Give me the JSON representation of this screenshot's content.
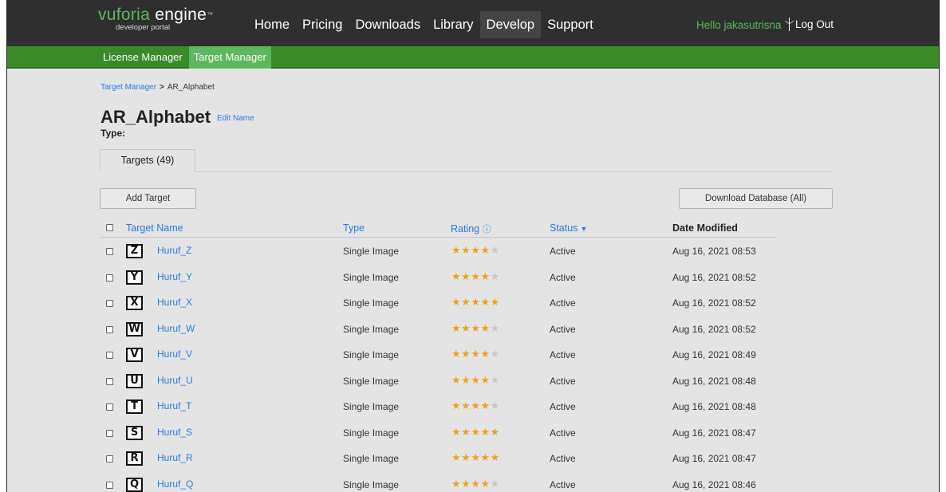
{
  "header": {
    "logo_main": "vuforia",
    "logo_engine": "engine",
    "logo_tm": "™",
    "logo_sub": "developer portal",
    "nav": [
      "Home",
      "Pricing",
      "Downloads",
      "Library",
      "Develop",
      "Support"
    ],
    "active_nav": "Develop",
    "greeting": "Hello jakasutrisna",
    "logout": "Log Out"
  },
  "subnav": {
    "items": [
      "License Manager",
      "Target Manager"
    ],
    "active": "Target Manager"
  },
  "breadcrumb": {
    "parent": "Target Manager",
    "separator": ">",
    "current": "AR_Alphabet"
  },
  "database": {
    "name": "AR_Alphabet",
    "edit_label": "Edit Name",
    "type_label": "Type:"
  },
  "tabs": [
    "Targets (49)"
  ],
  "actions": {
    "add_target": "Add Target",
    "download": "Download Database (All)"
  },
  "table": {
    "columns": {
      "name": "Target Name",
      "type": "Type",
      "rating": "Rating",
      "status": "Status",
      "date": "Date Modified"
    },
    "rows": [
      {
        "letter": "Z",
        "name": "Huruf_Z",
        "type": "Single Image",
        "rating": 4,
        "status": "Active",
        "date": "Aug 16, 2021 08:53"
      },
      {
        "letter": "Y",
        "name": "Huruf_Y",
        "type": "Single Image",
        "rating": 4,
        "status": "Active",
        "date": "Aug 16, 2021 08:52"
      },
      {
        "letter": "X",
        "name": "Huruf_X",
        "type": "Single Image",
        "rating": 5,
        "status": "Active",
        "date": "Aug 16, 2021 08:52"
      },
      {
        "letter": "W",
        "name": "Huruf_W",
        "type": "Single Image",
        "rating": 4,
        "status": "Active",
        "date": "Aug 16, 2021 08:52"
      },
      {
        "letter": "V",
        "name": "Huruf_V",
        "type": "Single Image",
        "rating": 4,
        "status": "Active",
        "date": "Aug 16, 2021 08:49"
      },
      {
        "letter": "U",
        "name": "Huruf_U",
        "type": "Single Image",
        "rating": 4,
        "status": "Active",
        "date": "Aug 16, 2021 08:48"
      },
      {
        "letter": "T",
        "name": "Huruf_T",
        "type": "Single Image",
        "rating": 4,
        "status": "Active",
        "date": "Aug 16, 2021 08:48"
      },
      {
        "letter": "S",
        "name": "Huruf_S",
        "type": "Single Image",
        "rating": 5,
        "status": "Active",
        "date": "Aug 16, 2021 08:47"
      },
      {
        "letter": "R",
        "name": "Huruf_R",
        "type": "Single Image",
        "rating": 5,
        "status": "Active",
        "date": "Aug 16, 2021 08:47"
      },
      {
        "letter": "Q",
        "name": "Huruf_Q",
        "type": "Single Image",
        "rating": 4,
        "status": "Active",
        "date": "Aug 16, 2021 08:46"
      }
    ]
  },
  "colors": {
    "topbar": "#2f2f2f",
    "green_bar": "#3a8a2a",
    "link_blue": "#2a7ae2",
    "star": "#f0a020"
  }
}
